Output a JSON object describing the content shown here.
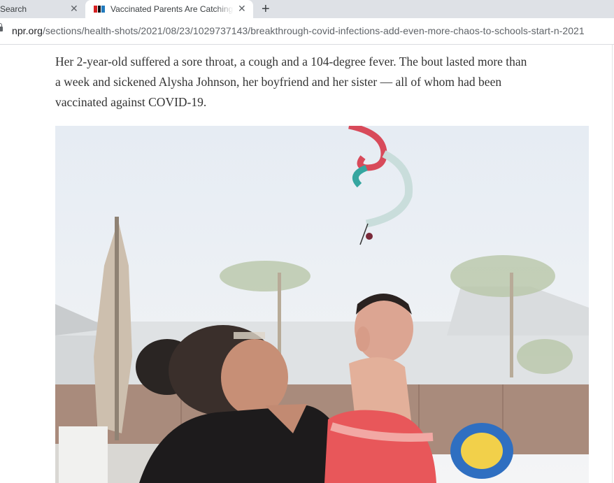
{
  "browser": {
    "tabs": [
      {
        "title": "Search",
        "active": false
      },
      {
        "title": "Vaccinated Parents Are Catching Covid",
        "active": true
      }
    ],
    "address": {
      "domain": "npr.org",
      "path": "/sections/health-shots/2021/08/23/1029737143/breakthrough-covid-infections-add-even-more-chaos-to-schools-start-n-2021"
    },
    "icons": {
      "close": "close-icon",
      "new_tab": "plus-icon",
      "lock": "lock-icon",
      "favicon": "npr-favicon"
    }
  },
  "article": {
    "paragraph": "Her 2-year-old suffered a sore throat, a cough and a 104-degree fever. The bout lasted more than a week and sickened Alysha Johnson, her boyfriend and her sister — all of whom had been vaccinated against COVID-19."
  },
  "colors": {
    "npr_red": "#d62021",
    "npr_black": "#000000",
    "npr_blue": "#237bbd"
  }
}
